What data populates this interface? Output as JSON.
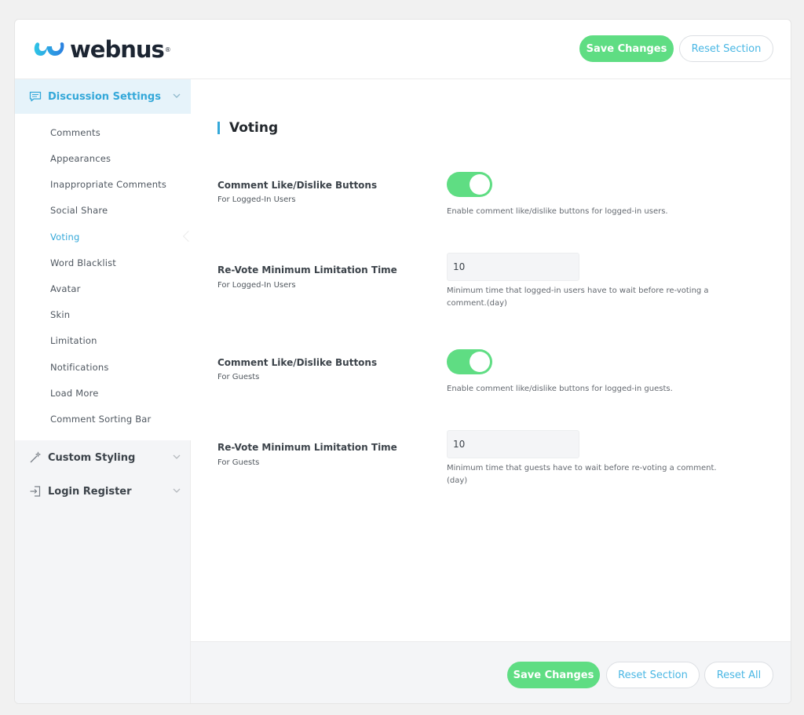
{
  "brand": {
    "name": "webnus",
    "reg": "®"
  },
  "header": {
    "save_label": "Save Changes",
    "reset_section_label": "Reset Section"
  },
  "sidebar": {
    "sections": [
      {
        "label": "Discussion Settings",
        "active": true
      },
      {
        "label": "Custom Styling",
        "active": false
      },
      {
        "label": "Login Register",
        "active": false
      }
    ],
    "items": [
      {
        "label": "Comments"
      },
      {
        "label": "Appearances"
      },
      {
        "label": "Inappropriate Comments"
      },
      {
        "label": "Social Share"
      },
      {
        "label": "Voting",
        "active": true
      },
      {
        "label": "Word Blacklist"
      },
      {
        "label": "Avatar"
      },
      {
        "label": "Skin"
      },
      {
        "label": "Limitation"
      },
      {
        "label": "Notifications"
      },
      {
        "label": "Load More"
      },
      {
        "label": "Comment Sorting Bar"
      }
    ]
  },
  "main": {
    "title": "Voting",
    "fields": [
      {
        "label": "Comment Like/Dislike Buttons",
        "sub": "For Logged-In Users",
        "type": "toggle",
        "on": true,
        "desc": "Enable comment like/dislike buttons for logged-in users."
      },
      {
        "label": "Re-Vote Minimum Limitation Time",
        "sub": "For Logged-In Users",
        "type": "number",
        "value": "10",
        "desc": "Minimum time that logged-in users have to wait before re-voting a comment.(day)"
      },
      {
        "label": "Comment Like/Dislike Buttons",
        "sub": "For Guests",
        "type": "toggle",
        "on": true,
        "desc": "Enable comment like/dislike buttons for logged-in guests."
      },
      {
        "label": "Re-Vote Minimum Limitation Time",
        "sub": "For Guests",
        "type": "number",
        "value": "10",
        "desc": "Minimum time that guests have to wait before re-voting a comment.(day)"
      }
    ]
  },
  "footer": {
    "save_label": "Save Changes",
    "reset_section_label": "Reset Section",
    "reset_all_label": "Reset All"
  },
  "colors": {
    "accent": "#34a8d9",
    "success": "#5fdd83",
    "sidebar_bg": "#f4f5f7"
  },
  "icons": {
    "discussion": "speech-bubble-icon",
    "custom_styling": "magic-wand-icon",
    "login_register": "sign-in-icon",
    "chevron": "chevron-down-icon"
  }
}
